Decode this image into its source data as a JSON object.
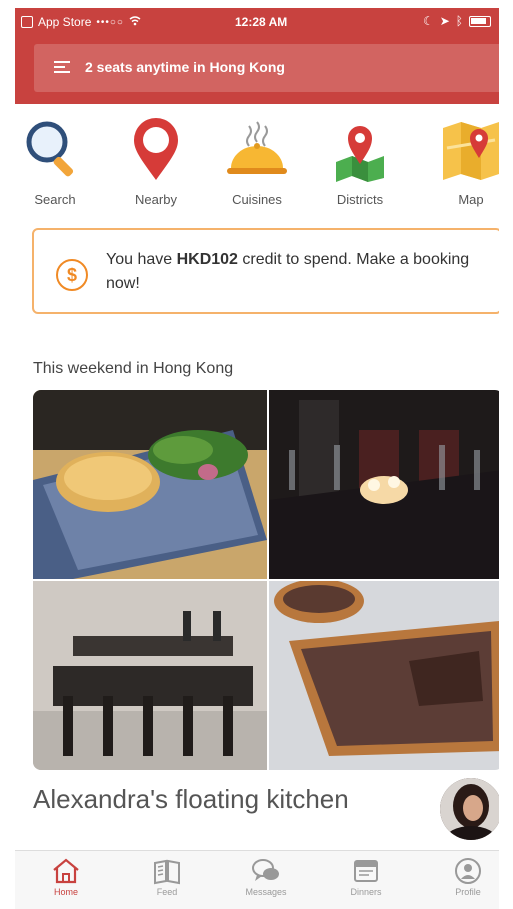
{
  "status_bar": {
    "carrier": "App Store",
    "signal": "•••○○",
    "time": "12:28 AM"
  },
  "search": {
    "summary": "2 seats anytime in Hong Kong"
  },
  "categories": [
    {
      "label": "Search",
      "icon": "magnifier-icon"
    },
    {
      "label": "Nearby",
      "icon": "location-pin-icon"
    },
    {
      "label": "Cuisines",
      "icon": "food-platter-icon"
    },
    {
      "label": "Districts",
      "icon": "map-pin-icon"
    },
    {
      "label": "Map",
      "icon": "folded-map-icon"
    }
  ],
  "credit": {
    "prefix": "You have ",
    "amount": "HKD102",
    "suffix": " credit to spend. Make a booking now!"
  },
  "section": {
    "title": "This weekend in Hong Kong"
  },
  "featured": {
    "title": "Alexandra's floating kitchen"
  },
  "tabs": [
    {
      "label": "Home",
      "icon": "home-icon",
      "active": true
    },
    {
      "label": "Feed",
      "icon": "book-icon",
      "active": false
    },
    {
      "label": "Messages",
      "icon": "chat-bubbles-icon",
      "active": false
    },
    {
      "label": "Dinners",
      "icon": "calendar-icon",
      "active": false
    },
    {
      "label": "Profile",
      "icon": "user-icon",
      "active": false
    }
  ],
  "colors": {
    "brand": "#c8423f",
    "accent": "#f08a25"
  }
}
